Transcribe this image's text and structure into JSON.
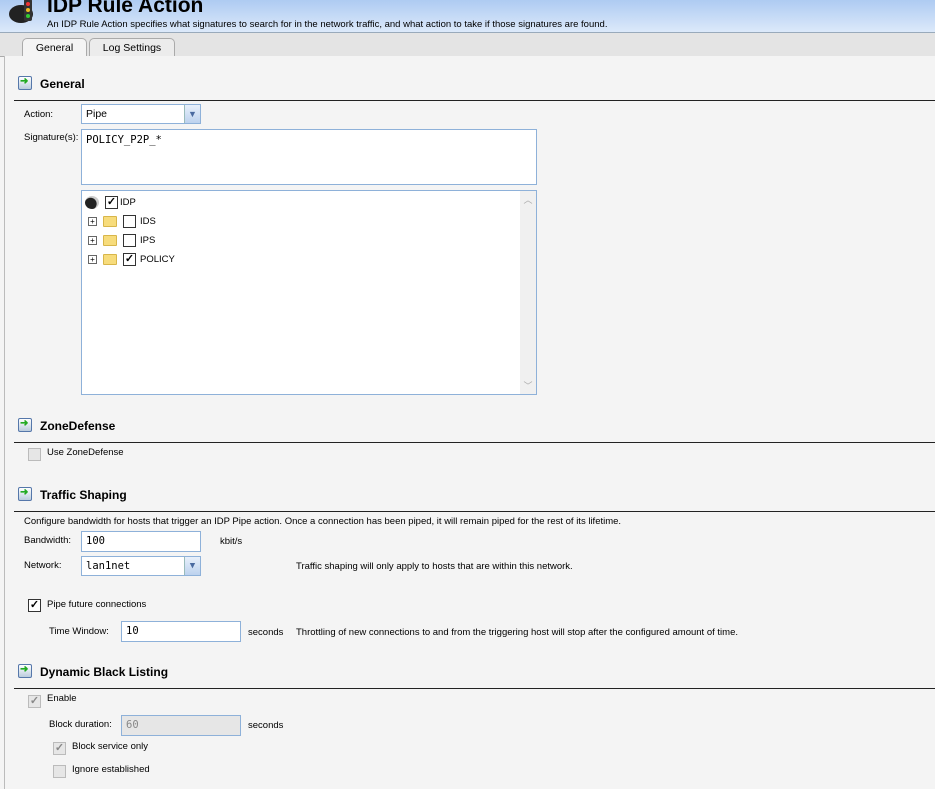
{
  "header": {
    "title": "IDP Rule Action",
    "subtitle": "An IDP Rule Action specifies what signatures to search for in the network traffic, and what action to take if those signatures are found."
  },
  "tabs": [
    {
      "label": "General",
      "active": true
    },
    {
      "label": "Log Settings",
      "active": false
    }
  ],
  "general": {
    "heading": "General",
    "action_label": "Action:",
    "action_value": "Pipe",
    "signatures_label": "Signature(s):",
    "signatures_value": "POLICY_P2P_*",
    "tree": {
      "root": {
        "label": "IDP",
        "checked": true
      },
      "children": [
        {
          "label": "IDS",
          "checked": false
        },
        {
          "label": "IPS",
          "checked": false
        },
        {
          "label": "POLICY",
          "checked": true
        }
      ]
    }
  },
  "zonedefense": {
    "heading": "ZoneDefense",
    "use_label": "Use ZoneDefense",
    "use_checked": false
  },
  "traffic": {
    "heading": "Traffic Shaping",
    "description": "Configure bandwidth for hosts that trigger an IDP Pipe action. Once a connection has been piped, it will remain piped for the rest of its lifetime.",
    "bandwidth_label": "Bandwidth:",
    "bandwidth_value": "100",
    "bandwidth_unit": "kbit/s",
    "network_label": "Network:",
    "network_value": "lan1net",
    "network_note": "Traffic shaping will only apply to hosts that are within this network.",
    "pipe_future_label": "Pipe future connections",
    "pipe_future_checked": true,
    "time_window_label": "Time Window:",
    "time_window_value": "10",
    "time_window_unit": "seconds",
    "time_window_note": "Throttling of new connections to and from the triggering host will stop after the configured amount of time."
  },
  "blacklist": {
    "heading": "Dynamic Black Listing",
    "enable_label": "Enable",
    "enable_checked": true,
    "block_duration_label": "Block duration:",
    "block_duration_value": "60",
    "block_duration_unit": "seconds",
    "block_service_label": "Block service only",
    "block_service_checked": true,
    "ignore_established_label": "Ignore established",
    "ignore_established_checked": false
  }
}
